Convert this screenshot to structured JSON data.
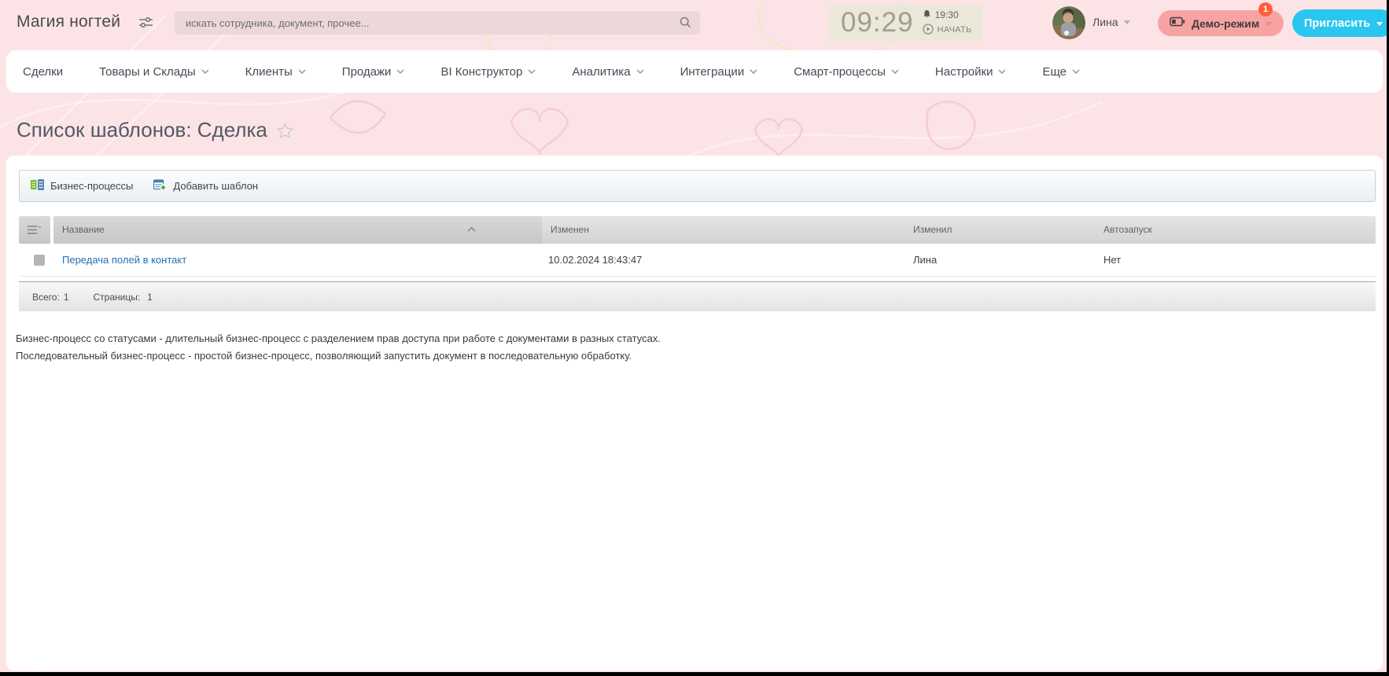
{
  "colors": {
    "background_pink": "#fce4e6",
    "demo_pill_pink": "#f8a3a3",
    "badge_orange": "#ff5f3d",
    "invite_cyan": "#29c6f0",
    "link_blue": "#2270b5",
    "clock_beige": "#ebe8d9"
  },
  "header": {
    "logo_title": "Магия ногтей",
    "search_placeholder": "искать сотрудника, документ, прочее...",
    "clock": {
      "time": "09:29",
      "alarm_time": "19:30",
      "start_label": "НАЧАТЬ"
    },
    "user_name": "Лина",
    "demo": {
      "label": "Демо-режим",
      "badge": "1"
    },
    "invite_label": "Пригласить"
  },
  "nav": {
    "items": [
      {
        "label": "Сделки",
        "has_dropdown": false
      },
      {
        "label": "Товары и Склады",
        "has_dropdown": true
      },
      {
        "label": "Клиенты",
        "has_dropdown": true
      },
      {
        "label": "Продажи",
        "has_dropdown": true
      },
      {
        "label": "BI Конструктор",
        "has_dropdown": true
      },
      {
        "label": "Аналитика",
        "has_dropdown": true
      },
      {
        "label": "Интеграции",
        "has_dropdown": true
      },
      {
        "label": "Смарт-процессы",
        "has_dropdown": true
      },
      {
        "label": "Настройки",
        "has_dropdown": true
      },
      {
        "label": "Еще",
        "has_dropdown": true
      }
    ]
  },
  "page": {
    "title": "Список шаблонов: Сделка"
  },
  "toolbar": {
    "business_processes_label": "Бизнес-процессы",
    "add_template_label": "Добавить шаблон"
  },
  "table": {
    "columns": [
      "Название",
      "Изменен",
      "Изменил",
      "Автозапуск"
    ],
    "sort_column": "Название",
    "sort_direction": "asc",
    "rows": [
      {
        "name": "Передача полей в контакт",
        "modified": "10.02.2024 18:43:47",
        "modified_by": "Лина",
        "autorun": "Нет"
      }
    ]
  },
  "grid_footer": {
    "total_label": "Всего:",
    "total_value": "1",
    "pages_label": "Страницы:",
    "pages_value": "1"
  },
  "description": {
    "line1": "Бизнес-процесс со статусами - длительный бизнес-процесс с разделением прав доступа при работе с документами в разных статусах.",
    "line2": "Последовательный бизнес-процесс - простой бизнес-процесс, позволяющий запустить документ в последовательную обработку."
  }
}
